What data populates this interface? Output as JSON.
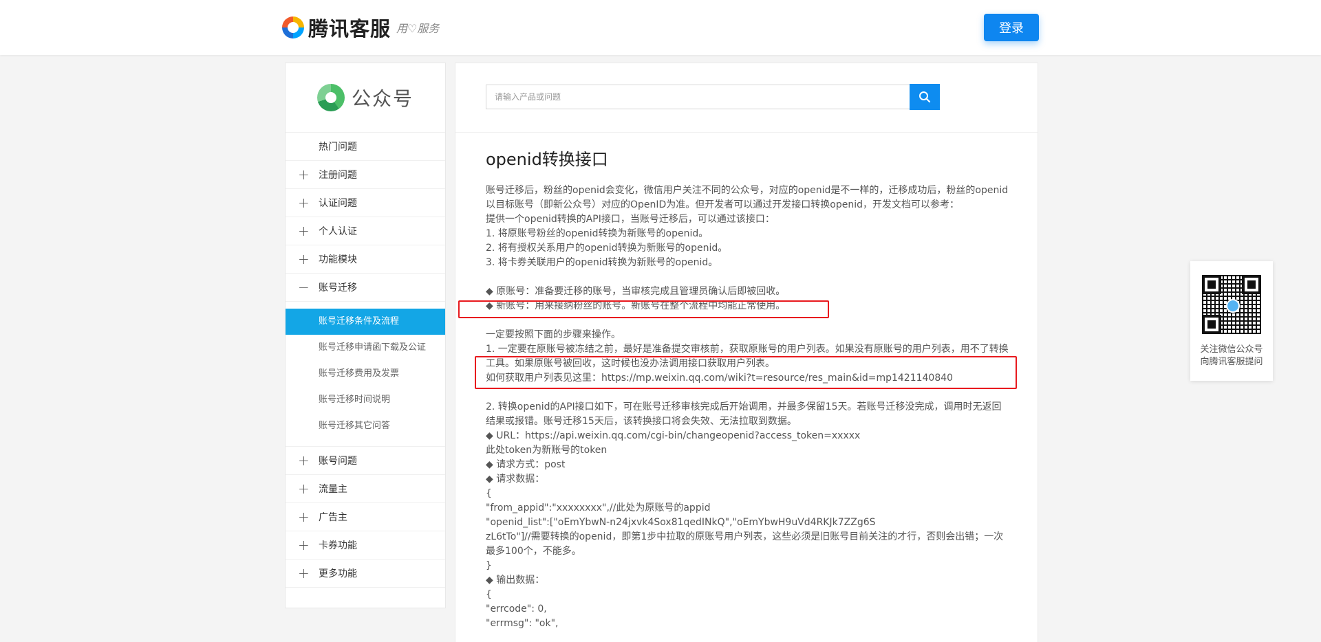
{
  "header": {
    "logo_text": "腾讯客服",
    "logo_slogan": "用♡服务",
    "login_label": "登录"
  },
  "sidebar": {
    "product_title": "公众号",
    "menu": [
      {
        "sign": "",
        "label": "热门问题"
      },
      {
        "sign": "+",
        "label": "注册问题"
      },
      {
        "sign": "+",
        "label": "认证问题"
      },
      {
        "sign": "+",
        "label": "个人认证"
      },
      {
        "sign": "+",
        "label": "功能模块"
      },
      {
        "sign": "−",
        "label": "账号迁移"
      }
    ],
    "submenu": [
      {
        "label": "账号迁移条件及流程",
        "active": true
      },
      {
        "label": "账号迁移申请函下载及公证",
        "active": false
      },
      {
        "label": "账号迁移费用及发票",
        "active": false
      },
      {
        "label": "账号迁移时间说明",
        "active": false
      },
      {
        "label": "账号迁移其它问答",
        "active": false
      }
    ],
    "menu_after": [
      {
        "sign": "+",
        "label": "账号问题"
      },
      {
        "sign": "+",
        "label": "流量主"
      },
      {
        "sign": "+",
        "label": "广告主"
      },
      {
        "sign": "+",
        "label": "卡券功能"
      },
      {
        "sign": "+",
        "label": "更多功能"
      }
    ]
  },
  "search": {
    "placeholder": "请输入产品或问题",
    "value": ""
  },
  "article": {
    "title": "openid转换接口",
    "intro": "账号迁移后，粉丝的openid会变化，微信用户关注不同的公众号，对应的openid是不一样的，迁移成功后，粉丝的openid以目标账号（即新公众号）对应的OpenID为准。但开发者可以通过开发接口转换openid，开发文档可以参考：",
    "lines": {
      "l1": "提供一个openid转换的API接口，当账号迁移后，可以通过该接口：",
      "l2": "1. 将原账号粉丝的openid转换为新账号的openid。",
      "l3": "2. 将有授权关系用户的openid转换为新账号的openid。",
      "l4": "3. 将卡券关联用户的openid转换为新账号的openid。",
      "l5": "◆ 原账号：准备要迁移的账号，当审核完成且管理员确认后即被回收。",
      "l6": "◆ 新账号：用来接纳粉丝的账号。新账号在整个流程中均能正常使用。",
      "l7": "一定要按照下面的步骤来操作。",
      "l8": "1. 一定要在原账号被冻结之前，最好是准备提交审核前，获取原账号的用户列表。如果没有原账号的用户列表，用不了转换工具。如果原账号被回收，这时候也没办法调用接口获取用户列表。",
      "l9": "如何获取用户列表见这里：https://mp.weixin.qq.com/wiki?t=resource/res_main&id=mp1421140840",
      "l10": "2. 转换openid的API接口如下，可在账号迁移审核完成后开始调用，并最多保留15天。若账号迁移没完成，调用时无返回结果或报错。账号迁移15天后，该转换接口将会失效、无法拉取到数据。",
      "l11": "◆ URL：https://api.weixin.qq.com/cgi-bin/changeopenid?access_token=xxxxx",
      "l12": "此处token为新账号的token",
      "l13": "◆ 请求方式：post",
      "l14": "◆ 请求数据：",
      "l15": "{",
      "l16": "\"from_appid\":\"xxxxxxxx\",//此处为原账号的appid",
      "l17": "\"openid_list\":[\"oEmYbwN-n24jxvk4Sox81qedINkQ\",\"oEmYbwH9uVd4RKJk7ZZg6S",
      "l18": "zL6tTo\"]//需要转换的openid，即第1步中拉取的原账号用户列表，这些必须是旧账号目前关注的才行，否则会出错；一次最多100个，不能多。",
      "l19": "}",
      "l20": "◆ 输出数据：",
      "l21": "{",
      "l22": "\"errcode\": 0,",
      "l23": "\"errmsg\": \"ok\","
    }
  },
  "qr_panel": {
    "caption_line1": "关注微信公众号",
    "caption_line2": "向腾讯客服提问"
  },
  "colors": {
    "accent_blue": "#0e86f0",
    "active_item": "#13a6e6",
    "highlight_red": "#e8191e"
  }
}
